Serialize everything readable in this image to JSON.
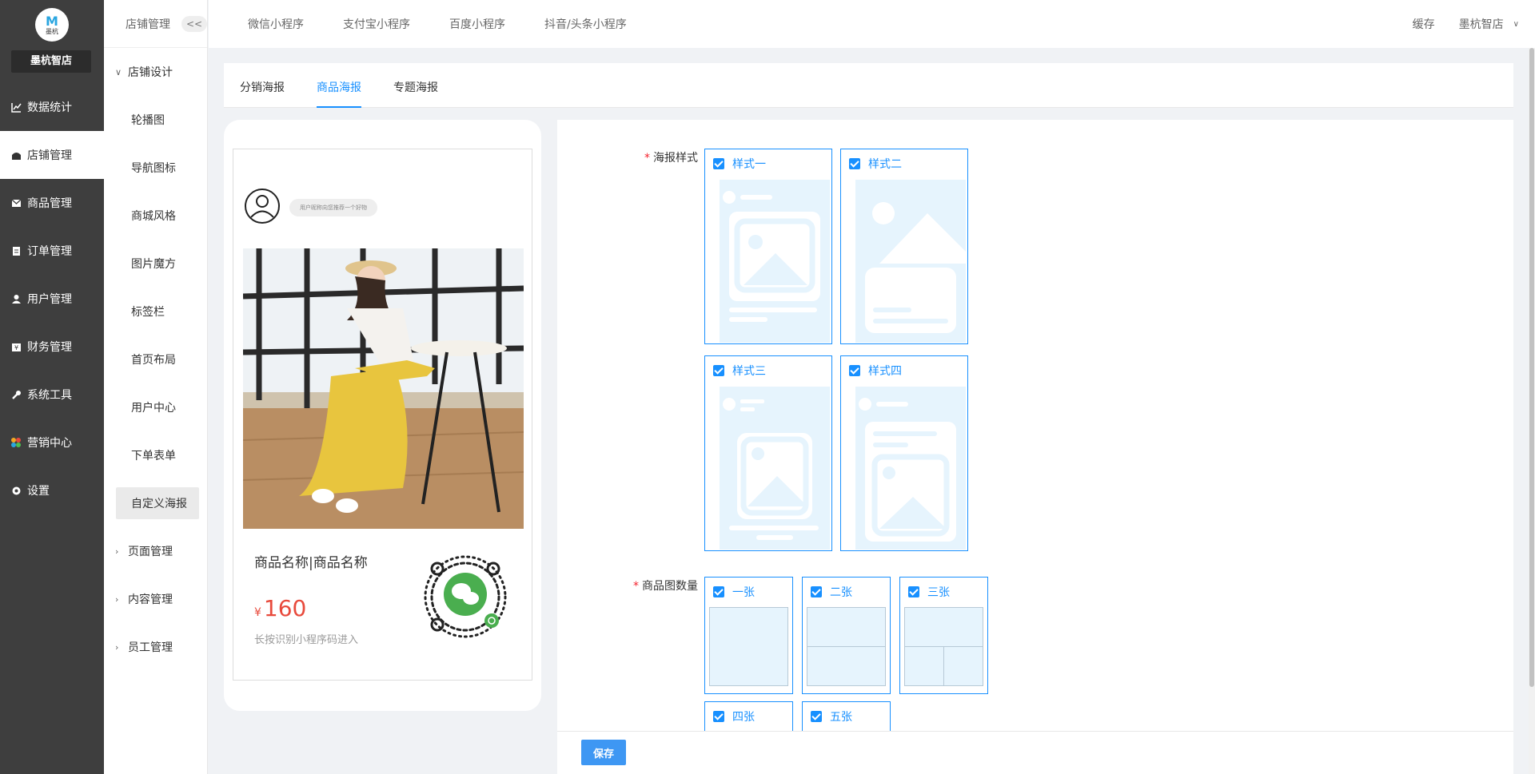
{
  "sidebar": {
    "logo_mark": "M",
    "logo_sub": "墨杭",
    "store_name": "墨杭智店",
    "items": [
      {
        "label": "数据统计",
        "icon": "chart-icon"
      },
      {
        "label": "店铺管理",
        "icon": "store-icon"
      },
      {
        "label": "商品管理",
        "icon": "mail-icon"
      },
      {
        "label": "订单管理",
        "icon": "clipboard-icon"
      },
      {
        "label": "用户管理",
        "icon": "user-icon"
      },
      {
        "label": "财务管理",
        "icon": "finance-icon"
      },
      {
        "label": "系统工具",
        "icon": "wrench-icon"
      },
      {
        "label": "营销中心",
        "icon": "marketing-icon"
      },
      {
        "label": "设置",
        "icon": "gear-icon"
      }
    ]
  },
  "subnav": {
    "title": "店铺管理",
    "collapse": "<<",
    "group1": "店铺设计",
    "items": [
      "轮播图",
      "导航图标",
      "商城风格",
      "图片魔方",
      "标签栏",
      "首页布局",
      "用户中心",
      "下单表单",
      "自定义海报"
    ],
    "group2": "页面管理",
    "group3": "内容管理",
    "group4": "员工管理"
  },
  "topbar": {
    "tabs": [
      "微信小程序",
      "支付宝小程序",
      "百度小程序",
      "抖音/头条小程序"
    ],
    "cache": "缓存",
    "user": "墨杭智店"
  },
  "page_tabs": [
    "分销海报",
    "商品海报",
    "专题海报"
  ],
  "preview": {
    "bubble": "用户昵称向您推荐一个好物",
    "product_name": "商品名称|商品名称",
    "currency": "¥",
    "price": "160",
    "tip": "长按识别小程序码进入"
  },
  "form": {
    "style_label": "海报样式",
    "styles": [
      "样式一",
      "样式二",
      "样式三",
      "样式四"
    ],
    "count_label": "商品图数量",
    "counts": [
      "一张",
      "二张",
      "三张",
      "四张",
      "五张"
    ]
  },
  "save_label": "保存",
  "colors": {
    "accent": "#1890ff",
    "sidebar": "#3e3e3e",
    "price": "#e84a3c"
  }
}
